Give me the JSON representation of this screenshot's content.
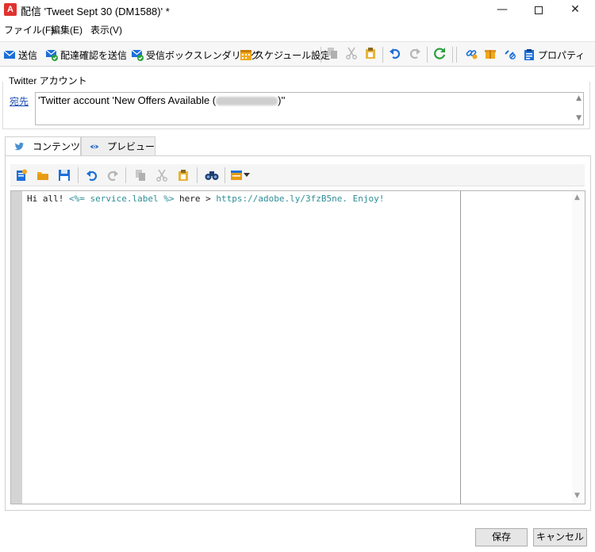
{
  "window": {
    "app_icon_letter": "A",
    "title": "配信 'Tweet Sept 30 (DM1588)' *",
    "minimize": "—",
    "close": "✕"
  },
  "menu": [
    "ファイル(F)",
    "編集(E)",
    "表示(V)"
  ],
  "toolbar": {
    "send": "送信",
    "send_proof": "配達確認を送信",
    "inbox_rendering": "受信ボックスレンダリング",
    "schedule": "スケジュール設定",
    "properties": "プロパティ"
  },
  "twitter_account": {
    "group_title": "Twitter アカウント",
    "to_link": "宛先",
    "to_value_prefix": "'Twitter account 'New Offers Available (",
    "to_value_suffix": ")''"
  },
  "tabs": {
    "content": "コンテンツ",
    "preview": "プレビュー"
  },
  "editor": {
    "text_1": "Hi all! ",
    "tag": "<%= service.label %>",
    "text_2": " here > ",
    "url": "https://adobe.ly/3fzB5ne. Enjoy!"
  },
  "buttons": {
    "save": "保存",
    "cancel": "キャンセル"
  },
  "colors": {
    "accent_blue": "#1d6fd8",
    "link": "#1d4fb5",
    "code_highlight": "#2e8e96",
    "app_red": "#e0322f",
    "green_refresh": "#2aa03b",
    "folder_yellow": "#f0a81e"
  }
}
